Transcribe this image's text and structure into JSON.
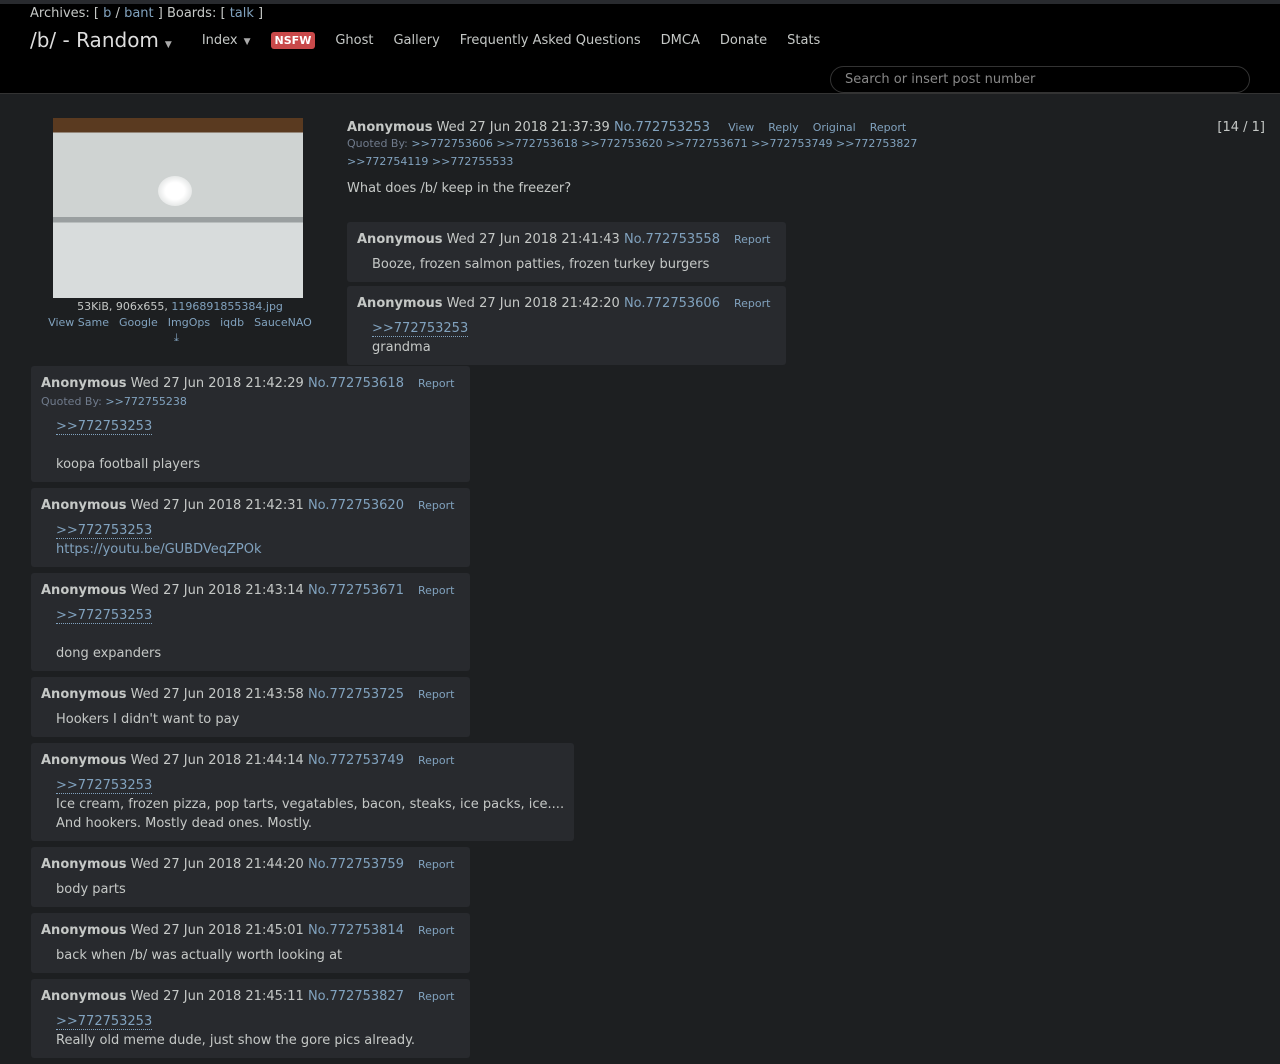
{
  "header": {
    "archives_label": "Archives: [",
    "archives": [
      "b",
      "bant"
    ],
    "boards_label": "Boards: [",
    "boards": [
      "talk"
    ],
    "board_title": "/b/ - Random",
    "nav": {
      "index": "Index",
      "nsfw": "NSFW",
      "ghost": "Ghost",
      "gallery": "Gallery",
      "faq": "Frequently Asked Questions",
      "dmca": "DMCA",
      "donate": "Donate",
      "stats": "Stats"
    },
    "search_placeholder": "Search or insert post number"
  },
  "op": {
    "file_info": "53KiB, 906x655, ",
    "file_name": "1196891855384.jpg",
    "file_links": [
      "View Same",
      "Google",
      "ImgOps",
      "iqdb",
      "SauceNAO"
    ],
    "name": "Anonymous",
    "date": "Wed 27 Jun 2018 21:37:39",
    "num": "No.772753253",
    "actions": [
      "View",
      "Reply",
      "Original",
      "Report"
    ],
    "quoted_label": "Quoted By:",
    "quoted_by": [
      ">>772753606",
      ">>772753618",
      ">>772753620",
      ">>772753671",
      ">>772753749",
      ">>772753827",
      ">>772754119",
      ">>772755533"
    ],
    "text": "What does /b/ keep in the freezer?",
    "counter": "[14 / 1]"
  },
  "op_replies": [
    {
      "name": "Anonymous",
      "date": "Wed 27 Jun 2018 21:41:43",
      "num": "No.772753558",
      "report": "Report",
      "lines": [
        "Booze, frozen salmon patties, frozen turkey burgers"
      ]
    },
    {
      "name": "Anonymous",
      "date": "Wed 27 Jun 2018 21:42:20",
      "num": "No.772753606",
      "report": "Report",
      "quote": ">>772753253",
      "lines": [
        "grandma"
      ]
    }
  ],
  "replies": [
    {
      "name": "Anonymous",
      "date": "Wed 27 Jun 2018 21:42:29",
      "num": "No.772753618",
      "report": "Report",
      "quoted_label": "Quoted By:",
      "quoted_by": ">>772755238",
      "quote": ">>772753253",
      "lines": [
        "",
        "koopa football players"
      ]
    },
    {
      "name": "Anonymous",
      "date": "Wed 27 Jun 2018 21:42:31",
      "num": "No.772753620",
      "report": "Report",
      "quote": ">>772753253",
      "link": "https://youtu.be/GUBDVeqZPOk",
      "lines": []
    },
    {
      "name": "Anonymous",
      "date": "Wed 27 Jun 2018 21:43:14",
      "num": "No.772753671",
      "report": "Report",
      "quote": ">>772753253",
      "lines": [
        "",
        "dong expanders"
      ]
    },
    {
      "name": "Anonymous",
      "date": "Wed 27 Jun 2018 21:43:58",
      "num": "No.772753725",
      "report": "Report",
      "lines": [
        "Hookers I didn't want to pay"
      ]
    },
    {
      "name": "Anonymous",
      "date": "Wed 27 Jun 2018 21:44:14",
      "num": "No.772753749",
      "report": "Report",
      "quote": ">>772753253",
      "lines": [
        "Ice cream, frozen pizza, pop tarts, vegatables, bacon, steaks, ice packs, ice....",
        "And hookers. Mostly dead ones. Mostly."
      ]
    },
    {
      "name": "Anonymous",
      "date": "Wed 27 Jun 2018 21:44:20",
      "num": "No.772753759",
      "report": "Report",
      "lines": [
        "body parts"
      ]
    },
    {
      "name": "Anonymous",
      "date": "Wed 27 Jun 2018 21:45:01",
      "num": "No.772753814",
      "report": "Report",
      "lines": [
        "back when /b/ was actually worth looking at"
      ]
    },
    {
      "name": "Anonymous",
      "date": "Wed 27 Jun 2018 21:45:11",
      "num": "No.772753827",
      "report": "Report",
      "quote": ">>772753253",
      "lines": [
        "Really old meme dude, just show the gore pics already."
      ]
    }
  ]
}
